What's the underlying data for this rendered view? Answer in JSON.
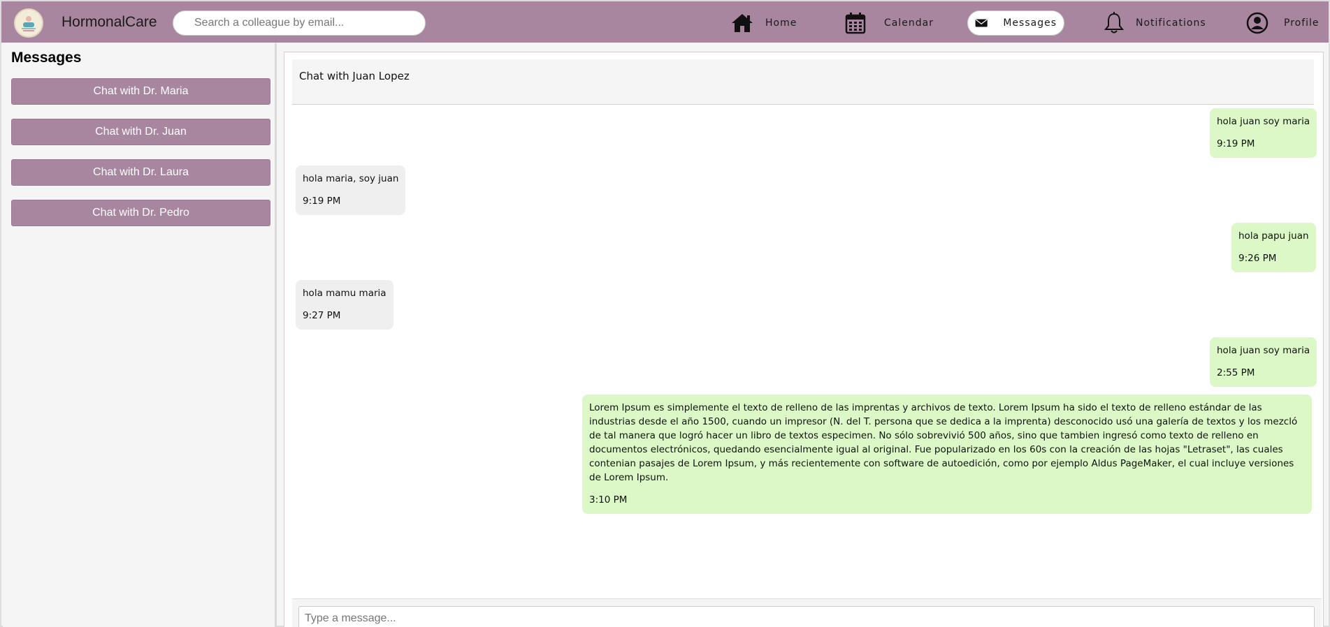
{
  "header": {
    "brand": "HormonalCare",
    "search_placeholder": "Search a colleague by email...",
    "nav": [
      {
        "label": "Home",
        "icon": "home-icon"
      },
      {
        "label": "Calendar",
        "icon": "calendar-icon"
      },
      {
        "label": "Messages",
        "icon": "mail-icon",
        "active": true
      },
      {
        "label": "Notifications",
        "icon": "bell-icon"
      },
      {
        "label": "Profile",
        "icon": "user-circle-icon"
      }
    ]
  },
  "sidebar": {
    "title": "Messages",
    "chats": [
      {
        "label": "Chat with Dr. Maria"
      },
      {
        "label": "Chat with Dr. Juan"
      },
      {
        "label": "Chat with Dr. Laura"
      },
      {
        "label": "Chat with Dr. Pedro"
      }
    ]
  },
  "chat": {
    "title": "Chat with Juan Lopez",
    "messages": [
      {
        "direction": "sent",
        "text": "hola juan soy maria",
        "time": "9:19 PM"
      },
      {
        "direction": "received",
        "text": "hola maria, soy juan",
        "time": "9:19 PM"
      },
      {
        "direction": "sent",
        "text": "hola papu juan",
        "time": "9:26 PM"
      },
      {
        "direction": "received",
        "text": "hola mamu maria",
        "time": "9:27 PM"
      },
      {
        "direction": "sent",
        "text": "hola juan soy maria",
        "time": "2:55 PM"
      },
      {
        "direction": "sent",
        "text": "Lorem Ipsum es simplemente el texto de relleno de las imprentas y archivos de texto. Lorem Ipsum ha sido el texto de relleno estándar de las industrias desde el año 1500, cuando un impresor (N. del T. persona que se dedica a la imprenta) desconocido usó una galería de textos y los mezcló de tal manera que logró hacer un libro de textos especimen. No sólo sobrevivió 500 años, sino que tambien ingresó como texto de relleno en documentos electrónicos, quedando esencialmente igual al original. Fue popularizado en los 60s con la creación de las hojas \"Letraset\", las cuales contenian pasajes de Lorem Ipsum, y más recientemente con software de autoedición, como por ejemplo Aldus PageMaker, el cual incluye versiones de Lorem Ipsum.",
        "time": "3:10 PM"
      }
    ],
    "input_placeholder": "Type a message..."
  },
  "colors": {
    "topbar": "#a8869f",
    "sent_bubble": "#dcf8c6",
    "received_bubble": "#efefef"
  }
}
